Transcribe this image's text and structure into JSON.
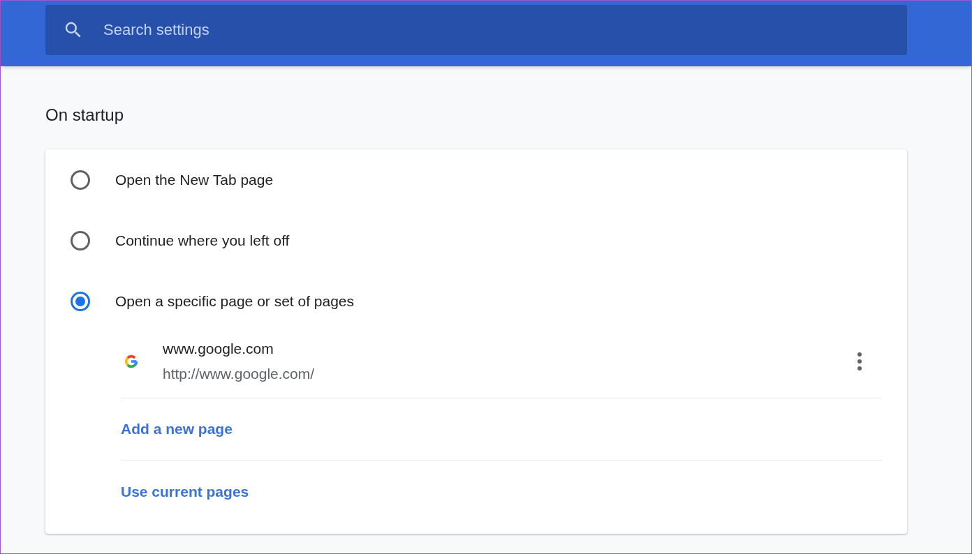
{
  "search": {
    "placeholder": "Search settings"
  },
  "section_title": "On startup",
  "options": [
    {
      "label": "Open the New Tab page",
      "selected": false
    },
    {
      "label": "Continue where you left off",
      "selected": false
    },
    {
      "label": "Open a specific page or set of pages",
      "selected": true
    }
  ],
  "pages": [
    {
      "title": "www.google.com",
      "url": "http://www.google.com/"
    }
  ],
  "actions": [
    "Add a new page",
    "Use current pages"
  ]
}
